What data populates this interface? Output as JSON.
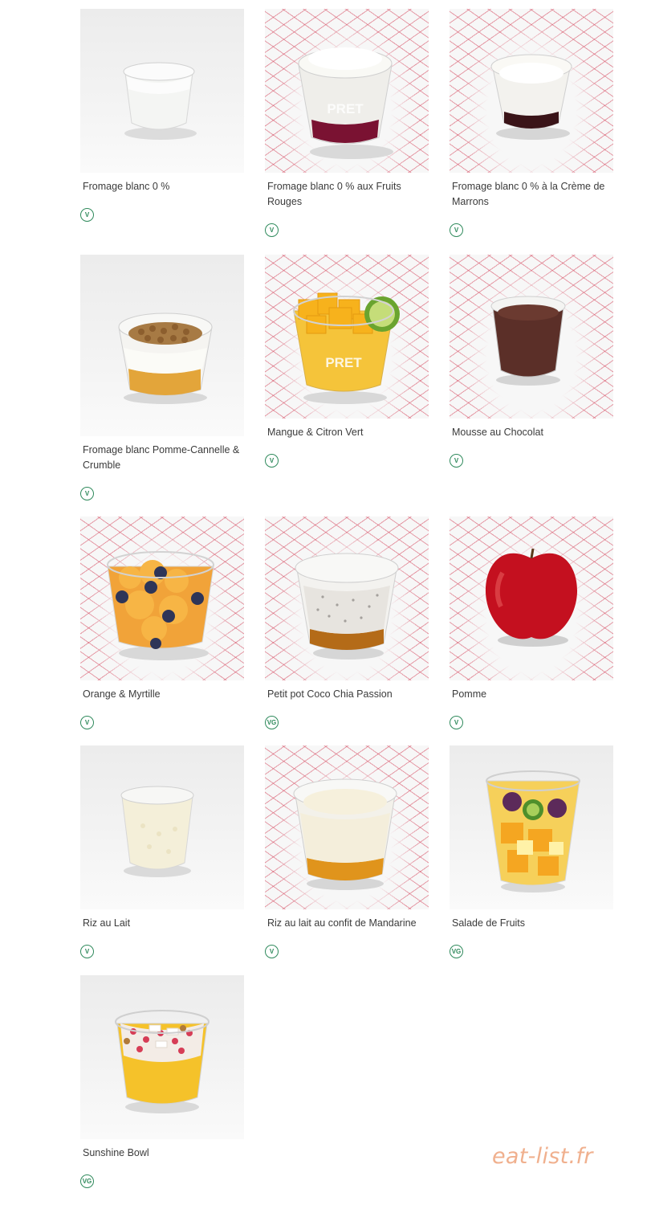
{
  "products": [
    {
      "name": "Fromage blanc 0 %",
      "badge": "V",
      "bg": "plain",
      "art": "yogurt-plain"
    },
    {
      "name": "Fromage blanc 0 % aux Fruits Rouges",
      "badge": "V",
      "bg": "star",
      "art": "yogurt-red"
    },
    {
      "name": "Fromage blanc 0 % à la Crème de Marrons",
      "badge": "V",
      "bg": "star",
      "art": "yogurt-chestnut"
    },
    {
      "name": "Fromage blanc Pomme-Cannelle & Crumble",
      "badge": "V",
      "bg": "plain",
      "art": "crumble-cup"
    },
    {
      "name": "Mangue & Citron Vert",
      "badge": "V",
      "bg": "star",
      "art": "mango-cup"
    },
    {
      "name": "Mousse au Chocolat",
      "badge": "V",
      "bg": "star",
      "art": "chocolate-mousse"
    },
    {
      "name": "Orange & Myrtille",
      "badge": "V",
      "bg": "star",
      "art": "orange-blueberry-cup"
    },
    {
      "name": "Petit pot Coco Chia Passion",
      "badge": "VG",
      "bg": "star",
      "art": "chia-pot"
    },
    {
      "name": "Pomme",
      "badge": "V",
      "bg": "star",
      "art": "apple"
    },
    {
      "name": "Riz au Lait",
      "badge": "V",
      "bg": "plain",
      "art": "rice-pudding"
    },
    {
      "name": "Riz au lait au confit de Mandarine",
      "badge": "V",
      "bg": "star",
      "art": "rice-mandarin"
    },
    {
      "name": "Salade de Fruits",
      "badge": "VG",
      "bg": "plain",
      "art": "fruit-salad"
    },
    {
      "name": "Sunshine Bowl",
      "badge": "VG",
      "bg": "plain",
      "art": "sunshine-bowl"
    }
  ],
  "cup_brand": "PRET",
  "watermark": "eat-list.fr",
  "colors": {
    "badge": "#2f8a5c",
    "star_lines": "#d64c62",
    "watermark": "#f0b08e"
  }
}
